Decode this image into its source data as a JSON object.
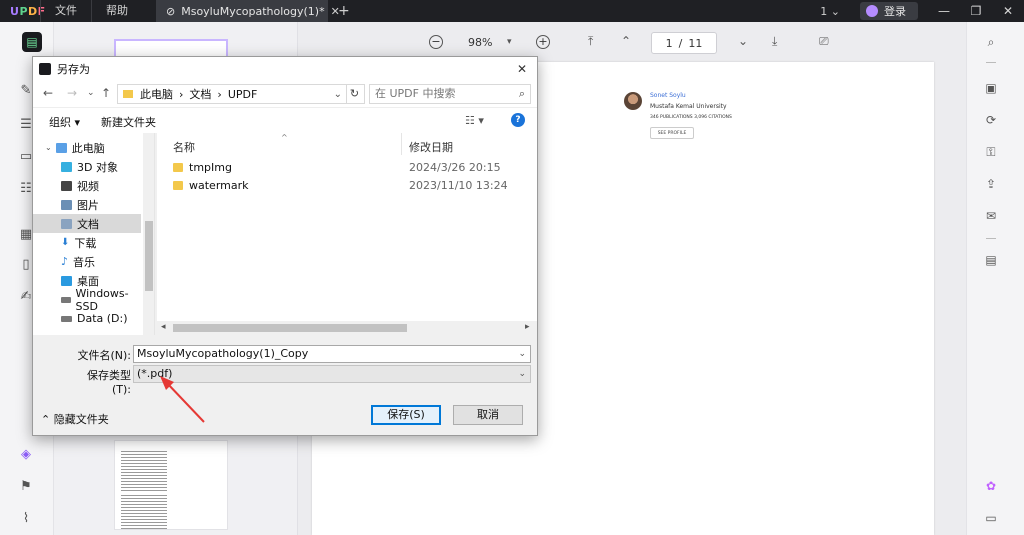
{
  "app": {
    "logo": "UPDF",
    "menu": [
      "文件",
      "帮助"
    ],
    "tab_title": "MsoyluMycopathology(1)*",
    "tab_close": "✕",
    "new_tab": "+",
    "window_count": "1",
    "login_label": "登录",
    "window_buttons": [
      "—",
      "❐",
      "✕"
    ]
  },
  "toolbar": {
    "zoom_out": "−",
    "zoom_value": "98%",
    "zoom_dropdown": "▾",
    "zoom_in": "+",
    "page_current": "1",
    "page_sep": "/",
    "page_total": "11"
  },
  "document": {
    "author_name": "Sonet Soylu",
    "author_university": "Mustafa Kemal University",
    "author_stats": "346 PUBLICATIONS   3,096 CITATIONS",
    "see_profile": "SEE PROFILE"
  },
  "dialog": {
    "title": "另存为",
    "close": "✕",
    "nav": {
      "back": "←",
      "forward": "→",
      "down": "⌄",
      "up": "↑"
    },
    "address": [
      "此电脑",
      "›",
      "文档",
      "›",
      "UPDF"
    ],
    "refresh": "↻",
    "search_placeholder": "在 UPDF 中搜索",
    "organize": "组织 ▾",
    "new_folder": "新建文件夹",
    "help": "?",
    "tree": [
      {
        "label": "此电脑",
        "color": "#5aa0e6"
      },
      {
        "label": "3D 对象",
        "color": "#36b0e0"
      },
      {
        "label": "视频",
        "color": "#444444"
      },
      {
        "label": "图片",
        "color": "#6b8fb5"
      },
      {
        "label": "文档",
        "color": "#8aa3c0"
      },
      {
        "label": "下载",
        "color": "#2a7fd4"
      },
      {
        "label": "音乐",
        "color": "#2a7fd4"
      },
      {
        "label": "桌面",
        "color": "#2a9ae0"
      },
      {
        "label": "Windows-SSD",
        "color": "#777777"
      },
      {
        "label": "Data (D:)",
        "color": "#777777"
      }
    ],
    "columns": {
      "name": "名称",
      "modified": "修改日期"
    },
    "files": [
      {
        "name": "tmpImg",
        "date": "2024/3/26 20:15"
      },
      {
        "name": "watermark",
        "date": "2023/11/10 13:24"
      }
    ],
    "filename_label": "文件名(N):",
    "filename_value": "MsoyluMycopathology(1)_Copy",
    "filetype_label": "保存类型(T):",
    "filetype_value": "(*.pdf)",
    "hide_folders": "隐藏文件夹",
    "save_button": "保存(S)",
    "cancel_button": "取消"
  },
  "colors": {
    "accent": "#0078d7",
    "annotation_arrow": "#e53935",
    "active_thumb_border": "#c9b6ff"
  }
}
